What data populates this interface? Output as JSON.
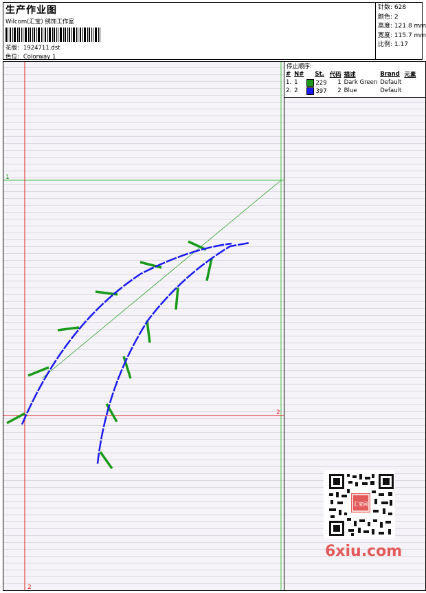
{
  "header": {
    "title": "生产作业图",
    "company": "Wilcom(汇宝) 绣饰工作室",
    "design_label": "花版:",
    "design_value": "1924711.dst",
    "colorway_label": "色位:",
    "colorway_value": "Colorway 1"
  },
  "stats": [
    {
      "label": "针数:",
      "value": "628"
    },
    {
      "label": "颜色:",
      "value": "2"
    },
    {
      "label": "高度:",
      "value": "121.8 mm"
    },
    {
      "label": "宽度:",
      "value": "115.7 mm"
    },
    {
      "label": "比例:",
      "value": "1.17"
    }
  ],
  "stop_sequence": {
    "title": "停止顺序:",
    "columns": [
      "#",
      "N#",
      "St.",
      "代码",
      "描述",
      "Brand",
      "元素"
    ],
    "rows": [
      {
        "num": "1.",
        "n": "1",
        "color": "#1a9a1a",
        "stitches": "229",
        "code": "1",
        "desc": "Dark Green",
        "brand": "Default",
        "element": ""
      },
      {
        "num": "2.",
        "n": "2",
        "color": "#1a1af0",
        "stitches": "397",
        "code": "2",
        "desc": "Blue",
        "brand": "Default",
        "element": ""
      }
    ]
  },
  "guides": {
    "h1_label": "1",
    "h2_label": "2",
    "v2_label": "2"
  },
  "colors": {
    "green": "#1a9a1a",
    "blue": "#1a1af0",
    "guide_red": "#e02020",
    "guide_green": "#40c040"
  },
  "watermark": "6xiu.com",
  "qr_stamp": "汇宝网"
}
